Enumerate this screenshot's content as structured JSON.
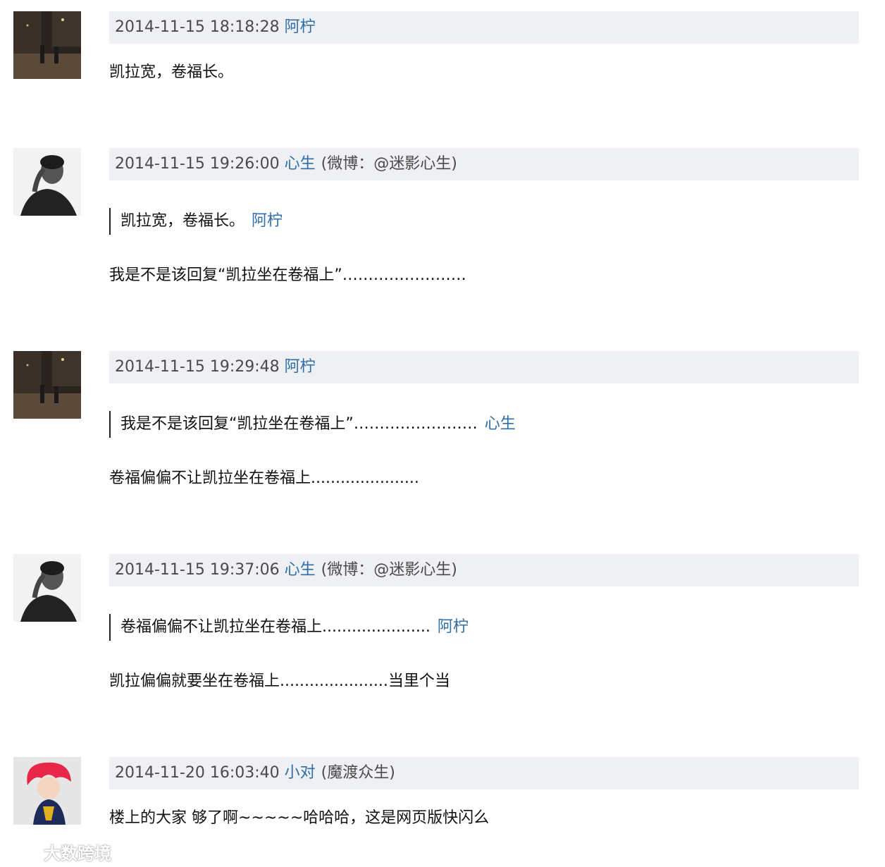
{
  "comments": [
    {
      "timestamp": "2014-11-15 18:18:28",
      "user": "阿柠",
      "extra": "",
      "quote_text": "",
      "quote_author": "",
      "text": "凯拉宽，卷福长。"
    },
    {
      "timestamp": "2014-11-15 19:26:00",
      "user": "心生",
      "extra": "(微博：@迷影心生)",
      "quote_text": "凯拉宽，卷福长。",
      "quote_author": "阿柠",
      "text": "我是不是该回复“凯拉坐在卷福上”……………………"
    },
    {
      "timestamp": "2014-11-15 19:29:48",
      "user": "阿柠",
      "extra": "",
      "quote_text": "我是不是该回复“凯拉坐在卷福上”……………………",
      "quote_author": "心生",
      "text": "卷福偏偏不让凯拉坐在卷福上......................"
    },
    {
      "timestamp": "2014-11-15 19:37:06",
      "user": "心生",
      "extra": "(微博：@迷影心生)",
      "quote_text": "卷福偏偏不让凯拉坐在卷福上......................",
      "quote_author": "阿柠",
      "text": "凯拉偏偏就要坐在卷福上......................当里个当"
    },
    {
      "timestamp": "2014-11-20 16:03:40",
      "user": "小对",
      "extra": "(魔渡众生)",
      "quote_text": "",
      "quote_author": "",
      "text": "楼上的大家 够了啊~~~~~哈哈哈，这是网页版快闪么"
    }
  ],
  "watermark": {
    "text": "大数跨境"
  },
  "colors": {
    "header_bg": "#eff0f3",
    "link": "#2f6ea5",
    "meta_text": "#4a4a4a",
    "body_text": "#111111"
  }
}
